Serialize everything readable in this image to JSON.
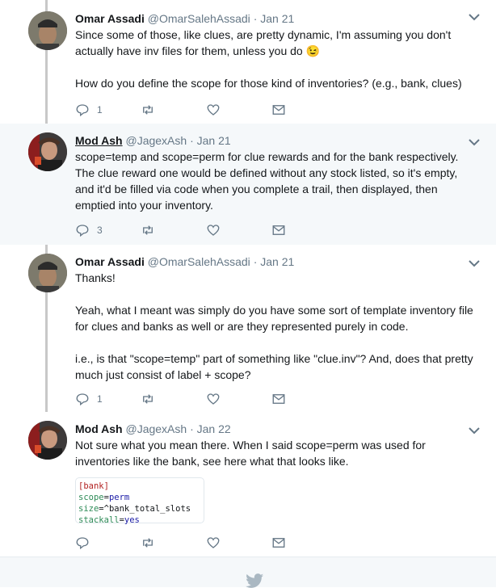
{
  "tweets": [
    {
      "name": "Omar Assadi",
      "handle": "@OmarSalehAssadi",
      "separator": "·",
      "date": "Jan 21",
      "paragraphs": [
        "Since some of those, like clues, are pretty dynamic, I'm assuming you don't actually have inv files for them, unless you do 😉",
        "How do you define the scope for those kind of inventories? (e.g., bank, clues)"
      ],
      "reply_count": "1"
    },
    {
      "name": "Mod Ash",
      "handle": "@JagexAsh",
      "separator": "·",
      "date": "Jan 21",
      "paragraphs": [
        "scope=temp and scope=perm for clue rewards and for the bank respectively. The clue reward one would be defined without any stock listed, so it's empty, and it'd be filled via code when you complete a trail, then displayed, then emptied into your inventory."
      ],
      "reply_count": "3"
    },
    {
      "name": "Omar Assadi",
      "handle": "@OmarSalehAssadi",
      "separator": "·",
      "date": "Jan 21",
      "paragraphs": [
        "Thanks!",
        "Yeah, what I meant was simply do you have some sort of template inventory file for clues and banks as well or are they represented purely in code.",
        "i.e., is that \"scope=temp\" part of something like \"clue.inv\"? And, does that pretty much just consist of label + scope?"
      ],
      "reply_count": "1"
    },
    {
      "name": "Mod Ash",
      "handle": "@JagexAsh",
      "separator": "·",
      "date": "Jan 22",
      "paragraphs": [
        "Not sure what you mean there. When I said scope=perm was used for inventories like the bank, see here what that looks like."
      ],
      "reply_count": "",
      "code": {
        "section": "[bank]",
        "line1_key": "scope",
        "line1_val": "perm",
        "line2_key": "size",
        "line2_val": "^bank_total_slots",
        "line3_key": "stackall",
        "line3_val": "yes",
        "eq": "="
      }
    }
  ],
  "icons": [
    "reply-icon",
    "retweet-icon",
    "like-icon",
    "dm-icon",
    "chevron-down-icon",
    "twitter-bird-icon"
  ],
  "colors": {
    "meta": "#657786",
    "highlight_bg": "#f5f8fa",
    "thread_line": "#c8c8c8"
  }
}
